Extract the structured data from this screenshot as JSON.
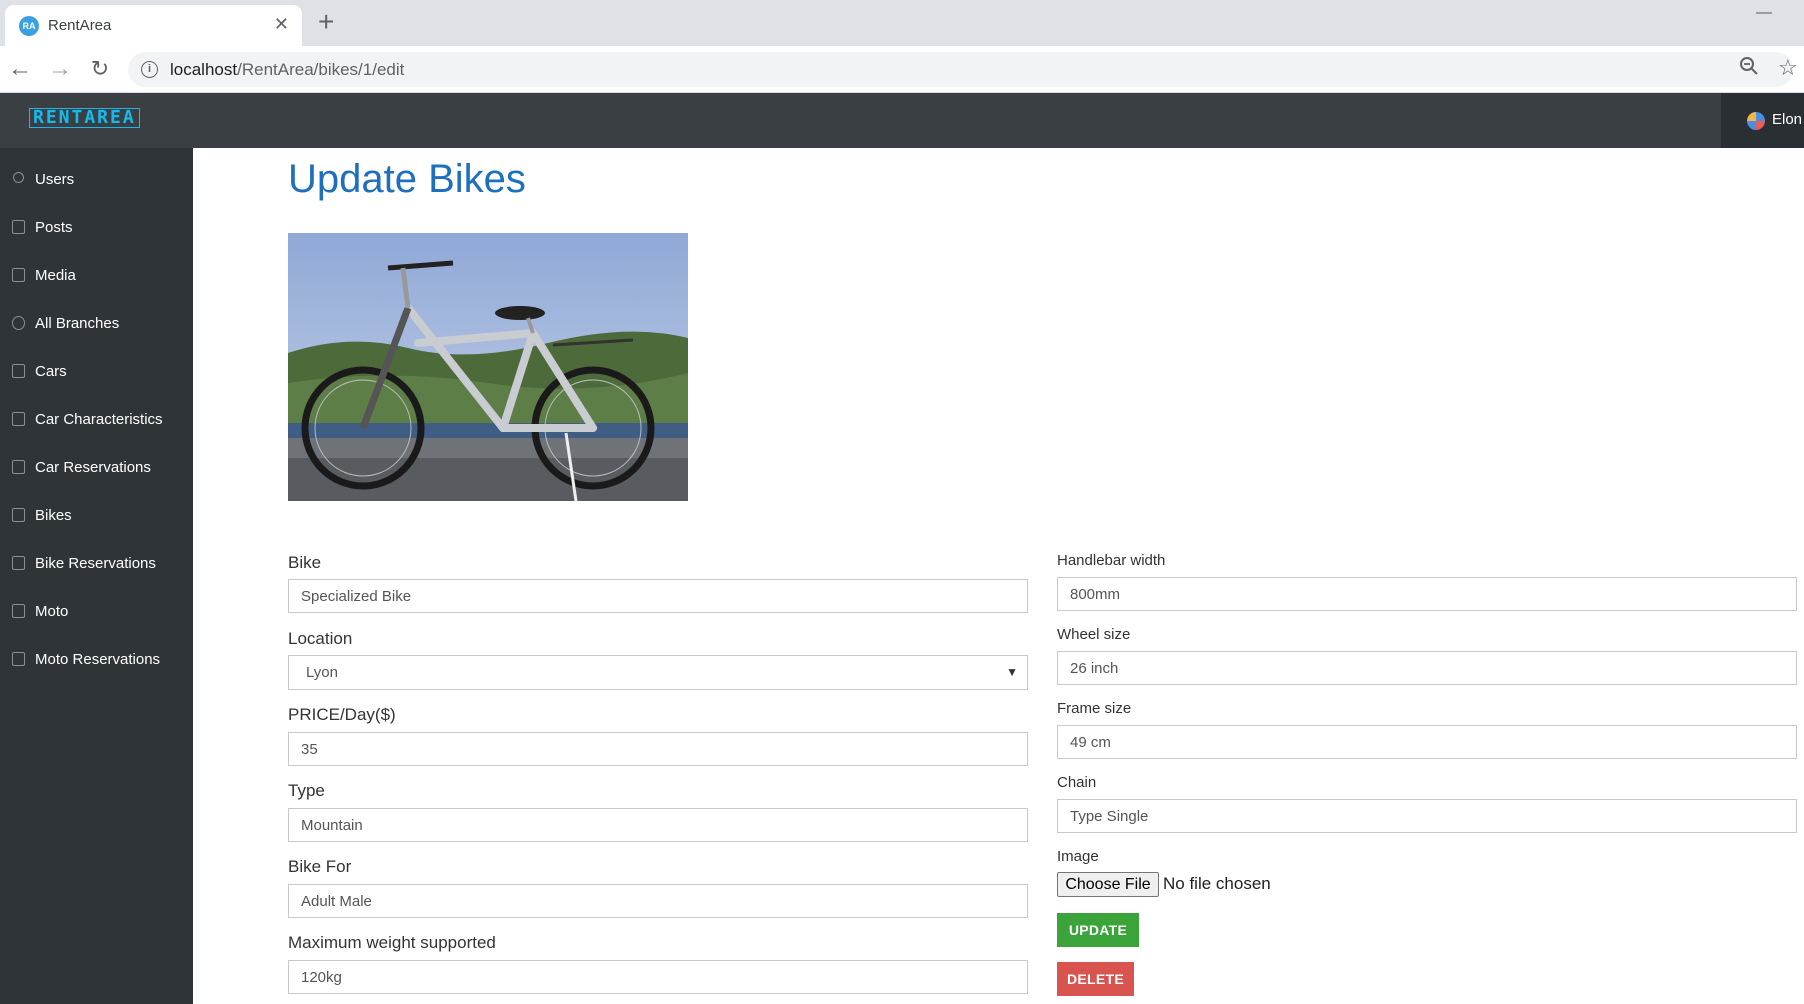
{
  "browser": {
    "tab_title": "RentArea",
    "tab_favicon_text": "RA",
    "tab_close": "✕",
    "new_tab": "+",
    "minimize": "—",
    "url_host": "localhost",
    "url_path": "/RentArea/bikes/1/edit"
  },
  "header": {
    "logo_text": "RENTAREA",
    "user_name": "Elon"
  },
  "sidebar": {
    "items": [
      {
        "label": "Users",
        "icon": "user-icon"
      },
      {
        "label": "Posts",
        "icon": "document-icon"
      },
      {
        "label": "Media",
        "icon": "image-icon"
      },
      {
        "label": "All Branches",
        "icon": "globe-icon"
      },
      {
        "label": "Cars",
        "icon": "image-icon"
      },
      {
        "label": "Car Characteristics",
        "icon": "image-icon"
      },
      {
        "label": "Car Reservations",
        "icon": "document-icon"
      },
      {
        "label": "Bikes",
        "icon": "image-icon"
      },
      {
        "label": "Bike Reservations",
        "icon": "document-icon"
      },
      {
        "label": "Moto",
        "icon": "image-icon"
      },
      {
        "label": "Moto Reservations",
        "icon": "document-icon"
      }
    ]
  },
  "page": {
    "title": "Update Bikes"
  },
  "form": {
    "bike": {
      "label": "Bike",
      "value": "Specialized Bike"
    },
    "location": {
      "label": "Location",
      "value": "Lyon"
    },
    "price": {
      "label": "PRICE/Day($)",
      "value": "35"
    },
    "type": {
      "label": "Type",
      "value": "Mountain"
    },
    "bike_for": {
      "label": "Bike For",
      "value": "Adult Male"
    },
    "max_weight": {
      "label": "Maximum weight supported",
      "value": "120kg"
    },
    "handlebar": {
      "label": "Handlebar width",
      "value": "800mm"
    },
    "wheel": {
      "label": "Wheel size",
      "value": "26 inch"
    },
    "frame": {
      "label": "Frame size",
      "value": "49 cm"
    },
    "chain": {
      "label": "Chain",
      "value": "Type Single"
    },
    "image": {
      "label": "Image",
      "button": "Choose File",
      "status": "No file chosen"
    },
    "update_label": "UPDATE",
    "delete_label": "DELETE"
  },
  "colors": {
    "title_blue": "#1f6fbf",
    "update_green": "#3aa43a",
    "delete_red": "#d9534f",
    "sidebar_bg": "#2f3438",
    "header_bg": "#3a3f44"
  }
}
